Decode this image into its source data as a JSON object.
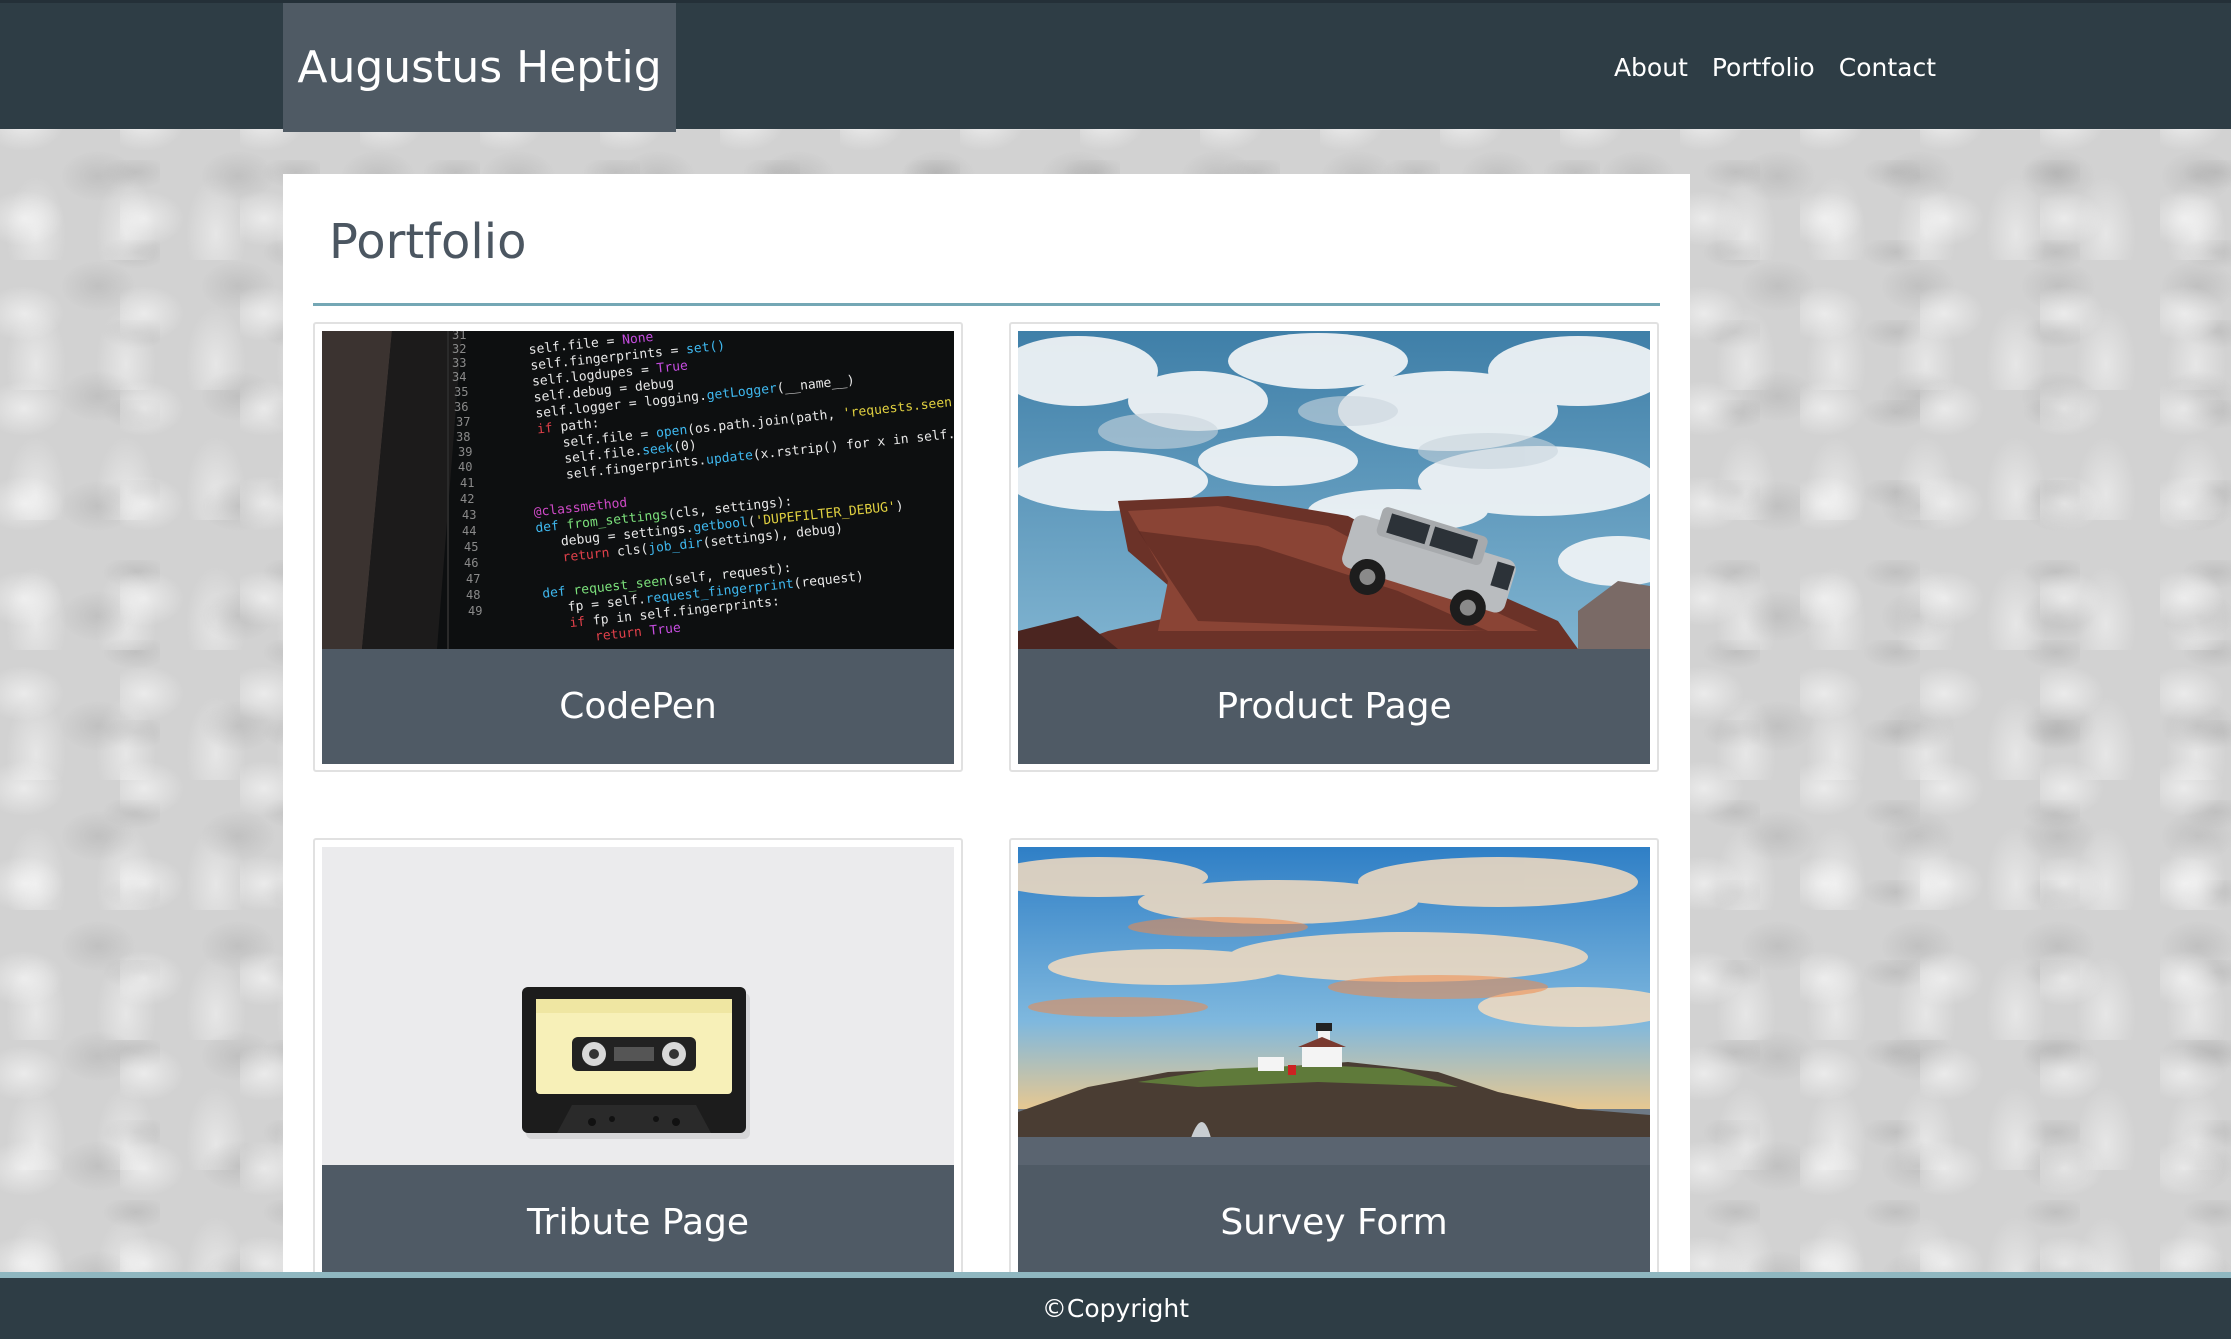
{
  "header": {
    "brand": "Augustus Heptig",
    "nav": [
      {
        "label": "About"
      },
      {
        "label": "Portfolio"
      },
      {
        "label": "Contact"
      }
    ]
  },
  "main": {
    "title": "Portfolio",
    "projects": [
      {
        "title": "CodePen",
        "image": "code-editor-screenshot"
      },
      {
        "title": "Product Page",
        "image": "suv-on-rock-cliff"
      },
      {
        "title": "Tribute Page",
        "image": "cassette-tape"
      },
      {
        "title": "Survey Form",
        "image": "lighthouse-island-sunset"
      }
    ]
  },
  "footer": {
    "text": "©Copyright"
  },
  "colors": {
    "header_bg": "#2e3d45",
    "brand_bg": "#4f5a64",
    "caption_bg": "#4f5a65",
    "accent_rule": "#74a7b5"
  }
}
